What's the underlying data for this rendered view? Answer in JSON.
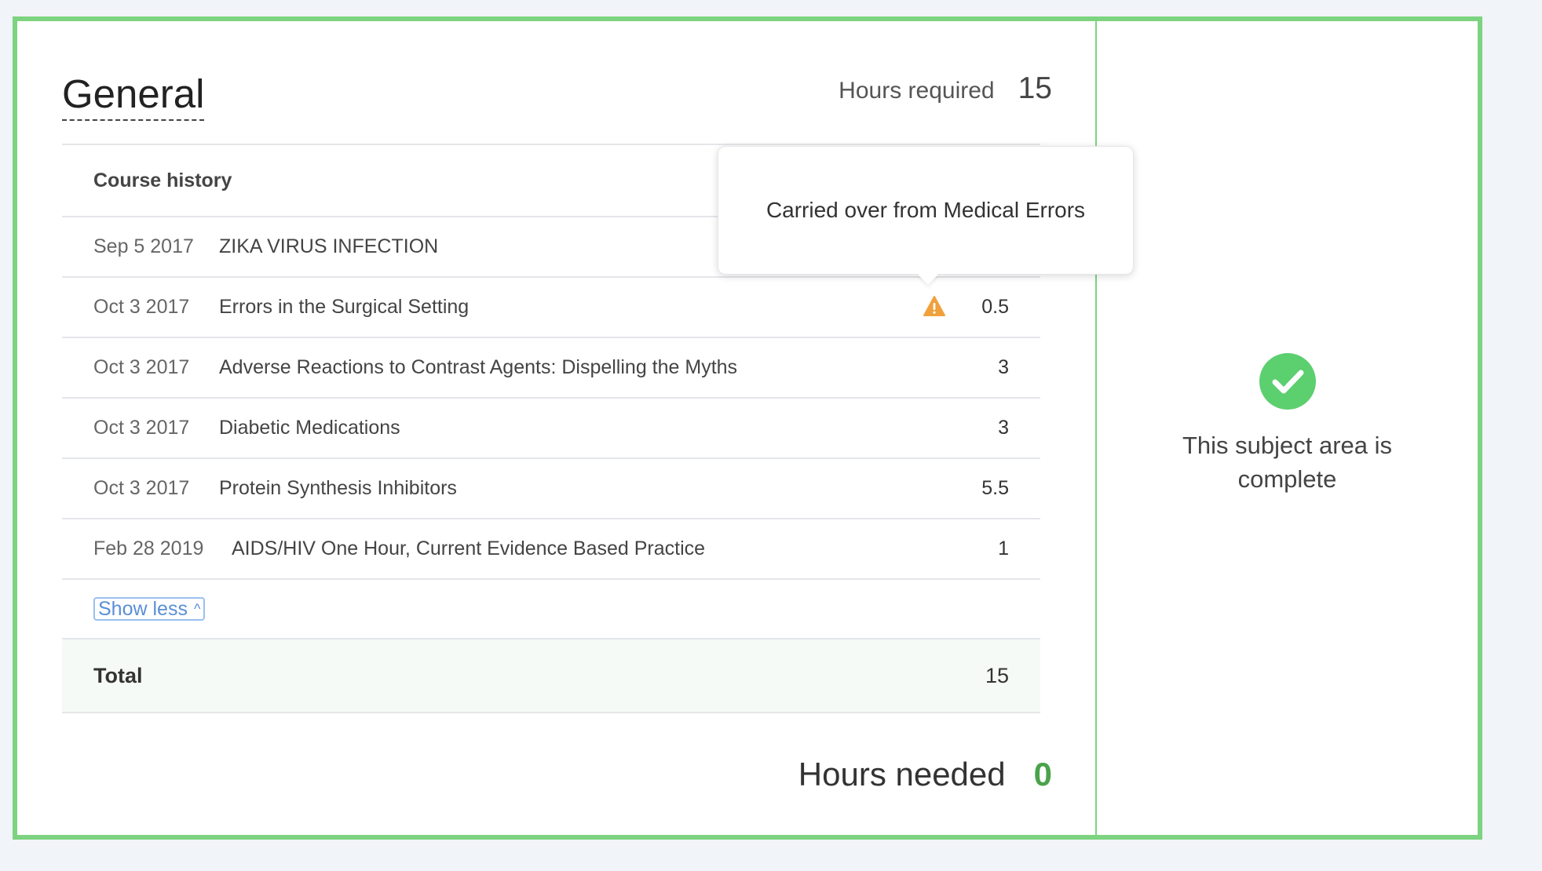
{
  "section": {
    "title": "General",
    "hours_required_label": "Hours required",
    "hours_required_value": "15"
  },
  "history": {
    "header": "Course history",
    "rows": [
      {
        "date": "Sep 5 2017",
        "course": "ZIKA VIRUS INFECTION",
        "hours": ""
      },
      {
        "date": "Oct 3 2017",
        "course": "Errors in the Surgical Setting",
        "hours": "0.5"
      },
      {
        "date": "Oct 3 2017",
        "course": "Adverse Reactions to Contrast Agents: Dispelling the Myths",
        "hours": "3"
      },
      {
        "date": "Oct 3 2017",
        "course": "Diabetic Medications",
        "hours": "3"
      },
      {
        "date": "Oct 3 2017",
        "course": "Protein Synthesis Inhibitors",
        "hours": "5.5"
      },
      {
        "date": "Feb 28 2019",
        "course": "AIDS/HIV One Hour, Current Evidence Based Practice",
        "hours": "1"
      }
    ],
    "show_less": "Show less"
  },
  "total": {
    "label": "Total",
    "value": "15"
  },
  "needed": {
    "label": "Hours needed",
    "value": "0"
  },
  "tooltip": {
    "text": "Carried over from Medical Errors"
  },
  "status": {
    "text": "This subject area is complete"
  },
  "colors": {
    "accent_green": "#7dd380",
    "check_green": "#5ccf6f",
    "warning_orange": "#f0a13c",
    "link_blue": "#5a8fd6"
  },
  "icons": {
    "warning": "warning-icon",
    "check": "check-circle-icon",
    "chevron": "chevron-up-icon"
  }
}
